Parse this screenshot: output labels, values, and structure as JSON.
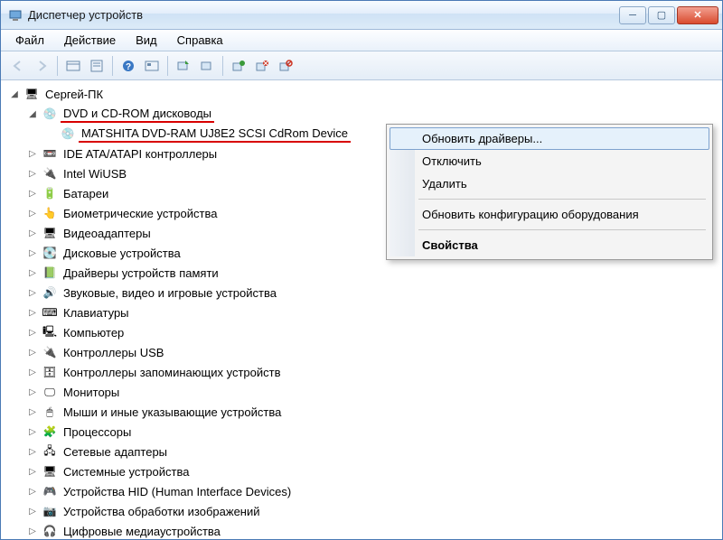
{
  "window": {
    "title": "Диспетчер устройств"
  },
  "menu": {
    "file": "Файл",
    "action": "Действие",
    "view": "Вид",
    "help": "Справка"
  },
  "tree": {
    "root": "Сергей-ПК",
    "dvd_category": "DVD и CD-ROM дисководы",
    "dvd_device": "MATSHITA DVD-RAM UJ8E2 SCSI CdRom Device",
    "categories": [
      "IDE ATA/ATAPI контроллеры",
      "Intel WiUSB",
      "Батареи",
      "Биометрические устройства",
      "Видеоадаптеры",
      "Дисковые устройства",
      "Драйверы устройств памяти",
      "Звуковые, видео и игровые устройства",
      "Клавиатуры",
      "Компьютер",
      "Контроллеры USB",
      "Контроллеры запоминающих устройств",
      "Мониторы",
      "Мыши и иные указывающие устройства",
      "Процессоры",
      "Сетевые адаптеры",
      "Системные устройства",
      "Устройства HID (Human Interface Devices)",
      "Устройства обработки изображений",
      "Цифровые медиаустройства"
    ]
  },
  "contextmenu": {
    "items": [
      {
        "label": "Обновить драйверы...",
        "hover": true
      },
      {
        "label": "Отключить"
      },
      {
        "label": "Удалить"
      },
      {
        "sep": true
      },
      {
        "label": "Обновить конфигурацию оборудования"
      },
      {
        "sep": true
      },
      {
        "label": "Свойства",
        "bold": true
      }
    ]
  },
  "icons": {
    "computer": "🖥",
    "disc": "💿",
    "ide": "📼",
    "usb": "🔌",
    "battery": "🔋",
    "biometric": "👆",
    "video": "🖥",
    "hdd": "💽",
    "memory": "📗",
    "audio": "🔊",
    "keyboard": "⌨",
    "pc": "🖳",
    "usbctrl": "🔌",
    "storage": "🗄",
    "monitor": "🖵",
    "mouse": "🖱",
    "cpu": "🧩",
    "network": "🖧",
    "system": "🖥",
    "hid": "🎮",
    "imaging": "📷",
    "media": "🎧"
  }
}
